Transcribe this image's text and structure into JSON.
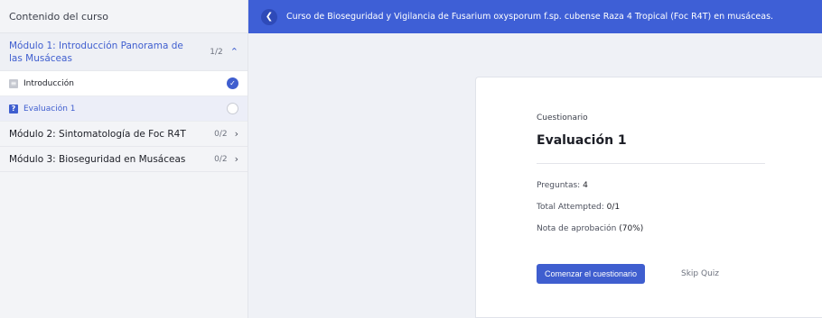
{
  "sidebar": {
    "header": "Contenido del curso",
    "modules": [
      {
        "title": "Módulo 1: Introducción Panorama de las Musáceas",
        "count": "1/2",
        "expanded": true,
        "lessons": [
          {
            "label": "Introducción",
            "icon": "document-icon",
            "status": "completed"
          },
          {
            "label": "Evaluación 1",
            "icon": "quiz-icon",
            "status": "incomplete"
          }
        ]
      },
      {
        "title": "Módulo 2: Sintomatología de Foc R4T",
        "count": "0/2",
        "expanded": false
      },
      {
        "title": "Módulo 3: Bioseguridad en Musáceas",
        "count": "0/2",
        "expanded": false
      }
    ]
  },
  "topbar": {
    "title": "Curso de Bioseguridad y Vigilancia de Fusarium oxysporum f.sp. cubense Raza 4 Tropical (Foc R4T) en musáceas."
  },
  "quiz": {
    "kicker": "Cuestionario",
    "title": "Evaluación 1",
    "questions_label": "Preguntas:",
    "questions_value": "4",
    "attempted_label": "Total Attempted:",
    "attempted_value": "0/1",
    "pass_label": "Nota de aprobación",
    "pass_value": "(70%)",
    "start_label": "Comenzar el cuestionario",
    "skip_label": "Skip Quiz"
  },
  "colors": {
    "accent": "#3f5ecf",
    "topbar": "#3e5fd6",
    "background": "#eff1f6"
  }
}
